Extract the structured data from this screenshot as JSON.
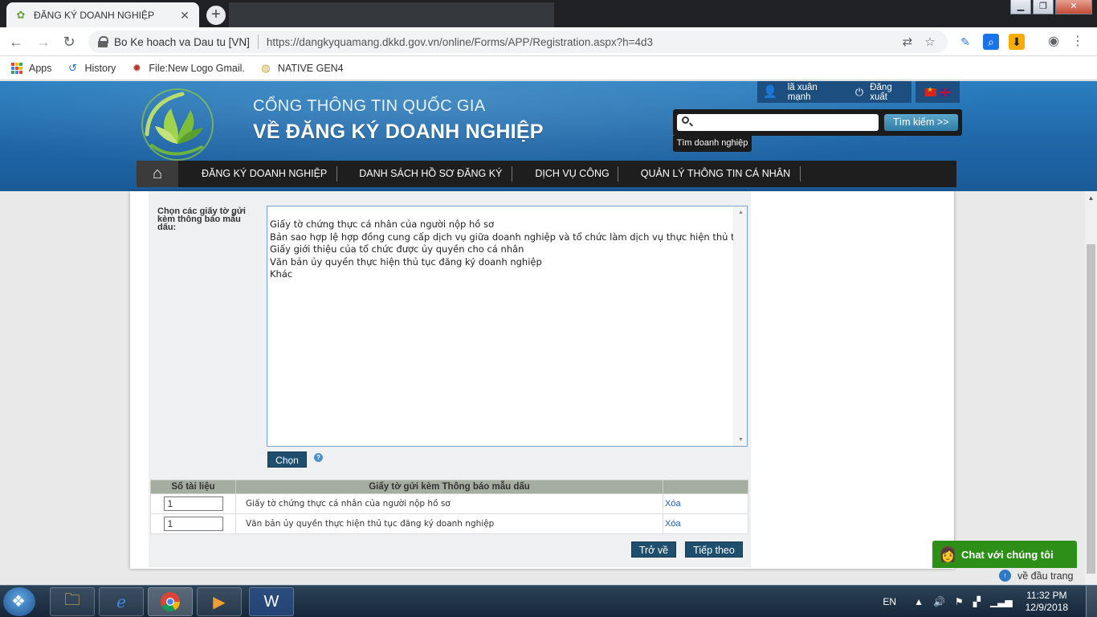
{
  "browser": {
    "tab_title": "ĐĂNG KÝ DOANH NGHIỆP",
    "tab_close": "✕",
    "new_tab": "+",
    "site_owner": "Bo Ke hoach va Dau tu [VN]",
    "url": "https://dangkyquamang.dkkd.gov.vn/online/Forms/APP/Registration.aspx?h=4d3",
    "bookmarks": [
      {
        "label": "Apps",
        "icon": "apps-grid-icon"
      },
      {
        "label": "History",
        "icon": "history-icon"
      },
      {
        "label": "File:New Logo Gmail.",
        "icon": "wikimedia-icon"
      },
      {
        "label": "NATIVE GEN4",
        "icon": "native-gen4-icon"
      }
    ]
  },
  "header": {
    "title_top": "CỔNG THÔNG TIN QUỐC GIA",
    "title_main": "VỀ ĐĂNG KÝ DOANH NGHIỆP",
    "user_name": "lã xuân mạnh",
    "logout": "Đăng xuất",
    "search_button": "Tìm kiếm >>",
    "search_placeholder": "",
    "search_sub": "Tìm doanh nghiệp"
  },
  "nav": {
    "items": [
      "ĐĂNG KÝ DOANH NGHIỆP",
      "DANH SÁCH HỒ SƠ ĐĂNG KÝ",
      "DỊCH VỤ CÔNG",
      "QUẢN LÝ THÔNG TIN CÁ NHÂN"
    ]
  },
  "form": {
    "choose_label": "Chọn các giấy tờ gửi kèm thông báo mẫu dấu:",
    "options": [
      "Giấy tờ chứng thực cá nhân của người nộp hồ sơ",
      "Bản sao hợp lệ hợp đồng cung cấp dịch vụ giữa doanh nghiệp và tổ chức làm dịch vụ thực hiện thủ tục",
      "Giấy giới thiệu của tổ chức được ủy quyền cho cá nhân",
      "Văn bản ủy quyền thực hiện thủ tục đăng ký doanh nghiệp",
      "Khác"
    ],
    "choose_button": "Chọn",
    "help": "?",
    "table": {
      "headers": [
        "Số tài liệu",
        "Giấy tờ gửi kèm Thông báo mẫu dấu",
        ""
      ],
      "rows": [
        {
          "qty": "1",
          "name": "Giấy tờ chứng thực cá nhân của người nộp hồ sơ",
          "action": "Xóa"
        },
        {
          "qty": "1",
          "name": "Văn bản ủy quyền thực hiện thủ tục đăng ký doanh nghiệp",
          "action": "Xóa"
        }
      ]
    },
    "back_button": "Trở về",
    "next_button": "Tiếp theo"
  },
  "widgets": {
    "chat": "Chat với chúng tôi",
    "back_to_top": "về đầu trang"
  },
  "taskbar": {
    "lang": "EN",
    "time": "11:32 PM",
    "date": "12/9/2018"
  },
  "colors": {
    "header_blue": "#2a7fc0",
    "nav_dark": "#1e1e1e",
    "button_navy": "#1f4f6f",
    "chat_green": "#2d8f17",
    "table_header": "#a5aca0"
  }
}
